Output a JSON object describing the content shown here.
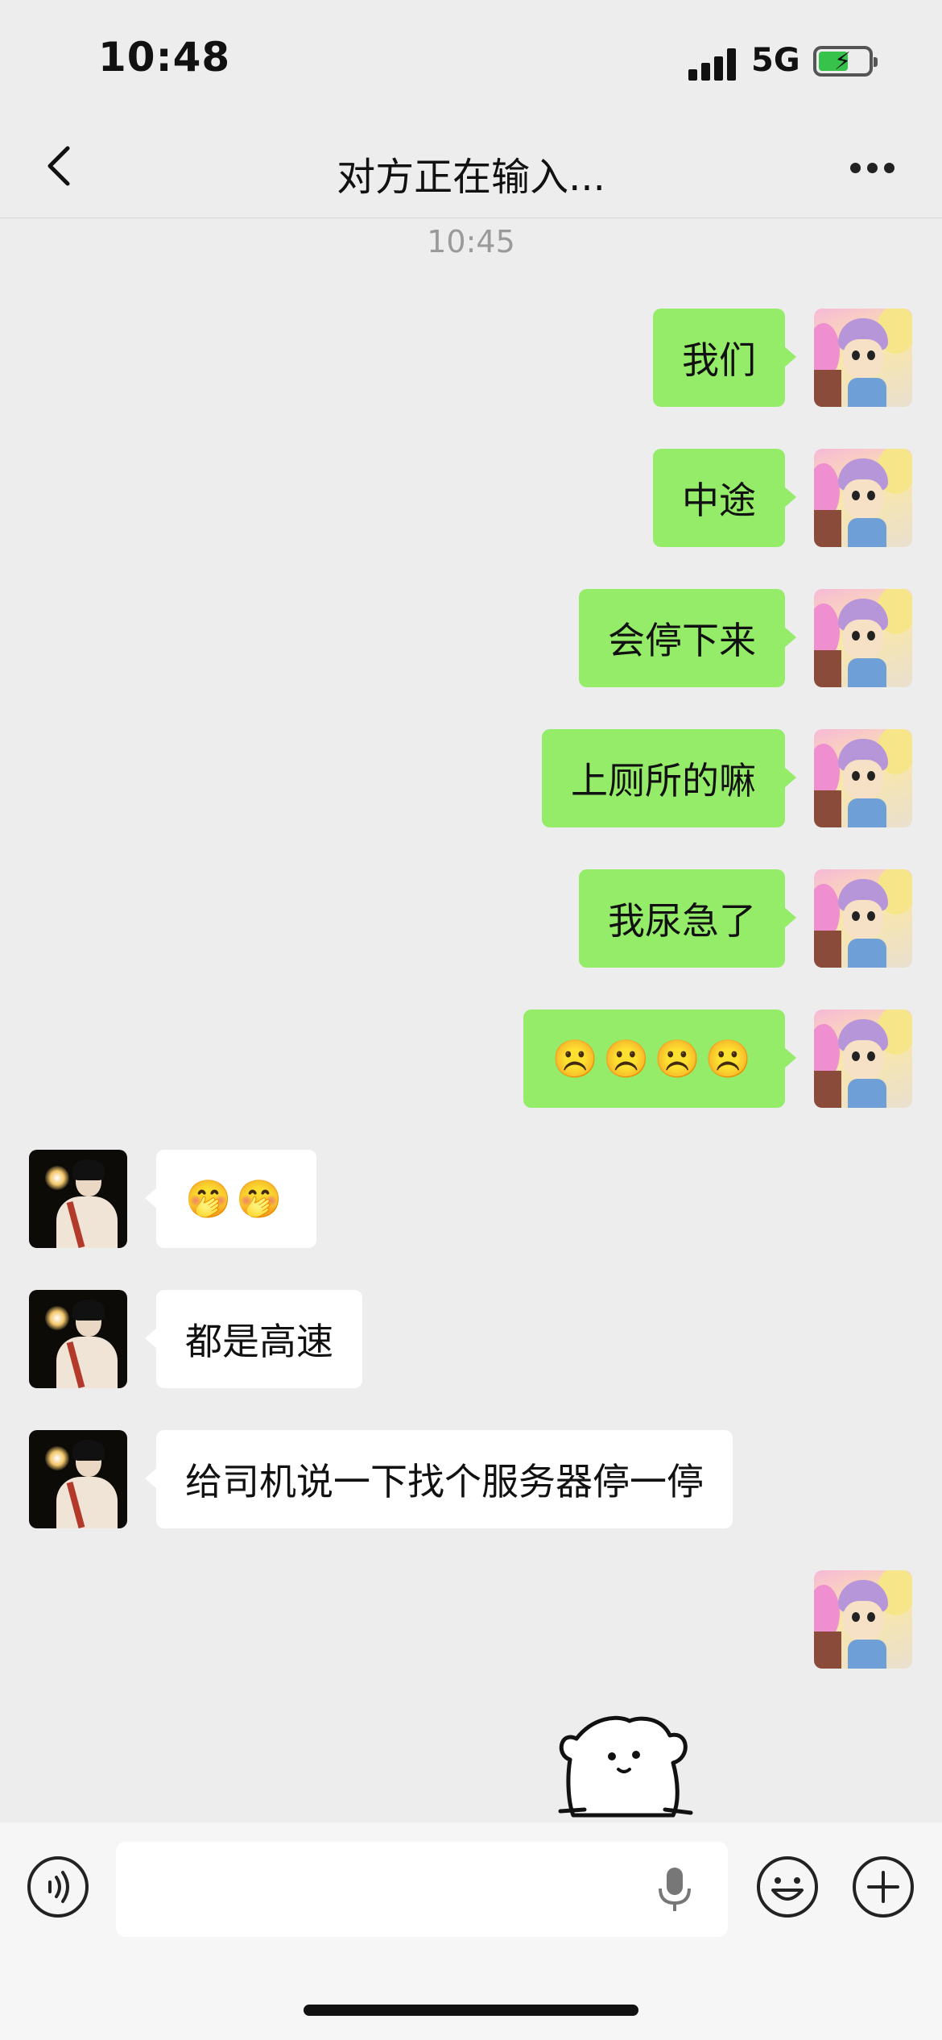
{
  "status_bar": {
    "time": "10:48",
    "network": "5G",
    "battery_charging": true
  },
  "header": {
    "title": "对方正在输入..."
  },
  "timestamp": "10:45",
  "messages": [
    {
      "from": "me",
      "text": "我们"
    },
    {
      "from": "me",
      "text": "中途"
    },
    {
      "from": "me",
      "text": "会停下来"
    },
    {
      "from": "me",
      "text": "上厕所的嘛"
    },
    {
      "from": "me",
      "text": "我尿急了"
    },
    {
      "from": "me",
      "text": "☹️☹️☹️☹️"
    },
    {
      "from": "other",
      "text": "🤭🤭"
    },
    {
      "from": "other",
      "text": "都是高速"
    },
    {
      "from": "other",
      "text": "给司机说一下找个服务器停一停"
    },
    {
      "from": "me",
      "type": "sticker",
      "sticker": "white-puppy-sticker"
    }
  ],
  "input": {
    "placeholder": "",
    "value": ""
  },
  "colors": {
    "background": "#ededed",
    "my_bubble": "#95ec69",
    "their_bubble": "#ffffff",
    "input_bar": "#f6f6f6"
  }
}
